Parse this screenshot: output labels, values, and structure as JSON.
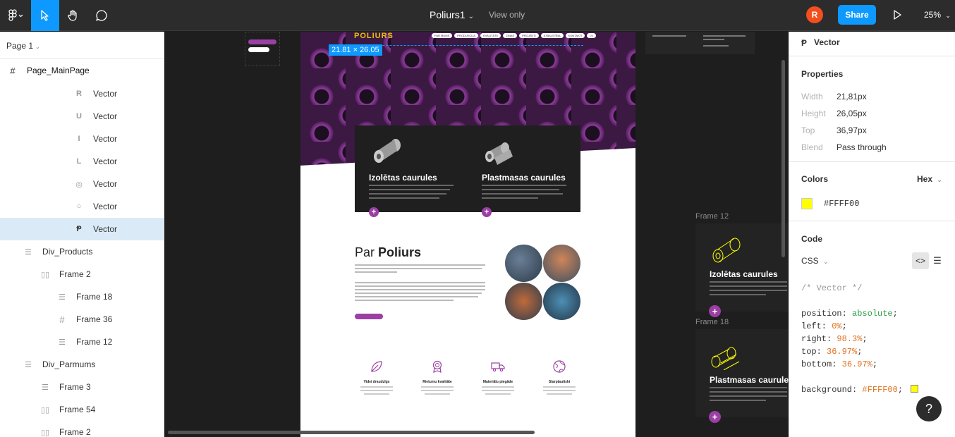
{
  "topbar": {
    "doc_title": "Poliurs1",
    "view_only": "View only",
    "avatar_initial": "R",
    "share_label": "Share",
    "zoom": "25%",
    "accent": "#0d99ff"
  },
  "left_panel": {
    "page": "Page 1",
    "layers": [
      {
        "label": "Page_MainPage",
        "icon": "frame-icon"
      },
      {
        "label": "Vector",
        "icon": "vector-r-icon"
      },
      {
        "label": "Vector",
        "icon": "vector-u-icon"
      },
      {
        "label": "Vector",
        "icon": "vector-i-icon"
      },
      {
        "label": "Vector",
        "icon": "vector-l-icon"
      },
      {
        "label": "Vector",
        "icon": "vector-o-outline-icon"
      },
      {
        "label": "Vector",
        "icon": "vector-o-icon"
      },
      {
        "label": "Vector",
        "icon": "vector-p-icon",
        "selected": true
      },
      {
        "label": "Div_Products",
        "icon": "rows-icon"
      },
      {
        "label": "Frame 2",
        "icon": "columns-icon"
      },
      {
        "label": "Frame 18",
        "icon": "rows-icon"
      },
      {
        "label": "Frame 36",
        "icon": "frame-icon"
      },
      {
        "label": "Frame 12",
        "icon": "rows-icon"
      },
      {
        "label": "Div_Parmums",
        "icon": "rows-icon"
      },
      {
        "label": "Frame 3",
        "icon": "rows-icon"
      },
      {
        "label": "Frame 54",
        "icon": "columns-icon"
      },
      {
        "label": "Frame 2",
        "icon": "columns-icon"
      }
    ]
  },
  "canvas": {
    "dimension_label": "21.81 × 26.05",
    "logo_text": "POLIURS",
    "nav_items": [
      "PAR MUMS",
      "PRODUKCIJA",
      "KVALITĀTE",
      "ZINAS",
      "PROJEKTI",
      "ATBALSTĪBA",
      "KONTAKTI",
      "LV"
    ],
    "cards": [
      {
        "title": "Izolētas caurules"
      },
      {
        "title": "Plastmasas caurules"
      }
    ],
    "par_title_prefix": "Par ",
    "par_title_brand": "Poliurs",
    "features": [
      "Videi draudzīgs",
      "Rietumu kvalitāte",
      "Materiālu piegāde",
      "Starptautiski"
    ],
    "frame_labels": [
      "Frame 12",
      "Frame 18"
    ],
    "frame_cards": [
      {
        "title": "Izolētas caurules"
      },
      {
        "title": "Plastmasas caurule"
      }
    ],
    "brand_purple": "#9b3fa4",
    "logo_yellow": "#e5c600"
  },
  "right_panel": {
    "layer_name": "Vector",
    "properties_header": "Properties",
    "properties": [
      {
        "label": "Width",
        "value": "21,81px"
      },
      {
        "label": "Height",
        "value": "26,05px"
      },
      {
        "label": "Top",
        "value": "36,97px"
      },
      {
        "label": "Blend",
        "value": "Pass through"
      }
    ],
    "colors_header": "Colors",
    "color_format": "Hex",
    "color_hex": "#FFFF00",
    "code_header": "Code",
    "code_lang": "CSS",
    "code": {
      "comment": "/* Vector */",
      "position_key": "position:",
      "position_val": "absolute",
      "left_key": "left:",
      "left_val": "0%",
      "right_key": "right:",
      "right_val": "98.3%",
      "top_key": "top:",
      "top_val": "36.97%",
      "bottom_key": "bottom:",
      "bottom_val": "36.97%",
      "bg_key": "background:",
      "bg_val": "#FFFF00"
    },
    "help": "?"
  }
}
